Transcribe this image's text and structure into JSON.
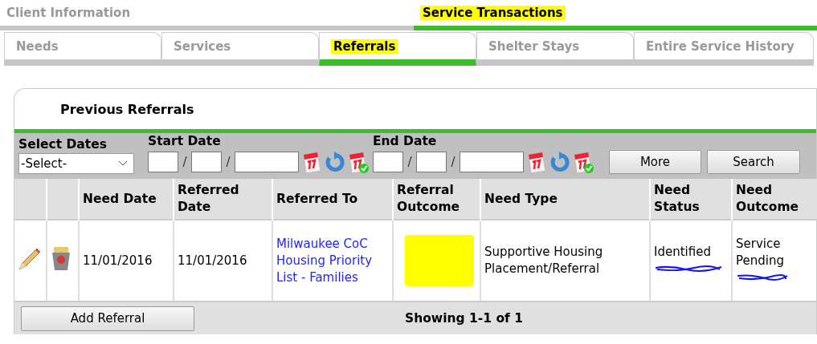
{
  "top_tabs": [
    {
      "label": "Client Information",
      "selected": false
    },
    {
      "label": "Service Transactions",
      "selected": true
    }
  ],
  "sub_tabs": [
    {
      "label": "Needs",
      "selected": false
    },
    {
      "label": "Services",
      "selected": false
    },
    {
      "label": "Referrals",
      "selected": true
    },
    {
      "label": "Shelter Stays",
      "selected": false
    },
    {
      "label": "Entire Service History",
      "selected": false
    }
  ],
  "panel": {
    "title": "Previous Referrals",
    "filters": {
      "select_dates": {
        "label": "Select Dates",
        "value": "-Select-"
      },
      "start_date": {
        "label": "Start Date",
        "separators": [
          "/",
          "/"
        ]
      },
      "end_date": {
        "label": "End Date",
        "separators": [
          "/",
          "/"
        ]
      },
      "buttons": [
        "More",
        "Search"
      ]
    },
    "table": {
      "columns": [
        "Need Date",
        "Referred Date",
        "Referred To",
        "Referral Outcome",
        "Need Type",
        "Need Status",
        "Need Outcome"
      ],
      "rows": [
        {
          "need_date": "11/01/2016",
          "referred_date": "11/01/2016",
          "referred_to": "Milwaukee CoC Housing Priority List - Families",
          "need_type": "Supportive Housing Placement/Referral",
          "need_status": "Identified",
          "need_outcome": "Service Pending"
        }
      ]
    },
    "footer": {
      "button": "Add Referral",
      "count": "Showing 1-1 of 1"
    }
  }
}
